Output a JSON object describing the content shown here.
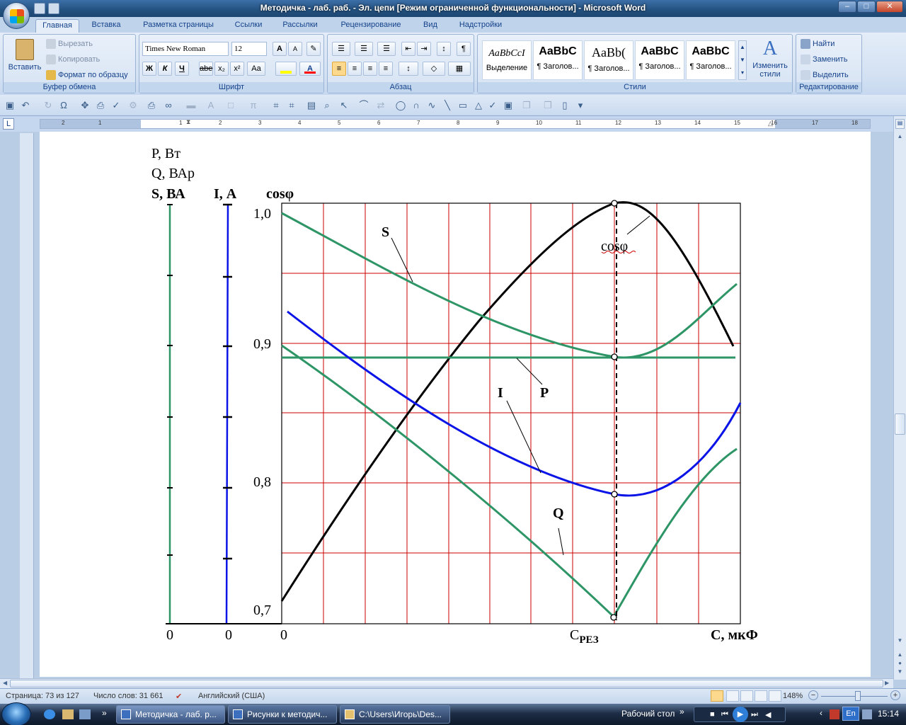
{
  "window": {
    "title": "Методичка - лаб. раб. - Эл. цепи [Режим ограниченной функциональности] - Microsoft Word",
    "buttons": [
      "–",
      "□",
      "✕"
    ]
  },
  "ribbon_tabs": [
    "Главная",
    "Вставка",
    "Разметка страницы",
    "Ссылки",
    "Рассылки",
    "Рецензирование",
    "Вид",
    "Надстройки"
  ],
  "clipboard": {
    "paste": "Вставить",
    "cut": "Вырезать",
    "copy": "Копировать",
    "format_painter": "Формат по образцу",
    "group": "Буфер обмена"
  },
  "font": {
    "name": "Times New Roman",
    "size": "12",
    "group": "Шрифт",
    "bold": "Ж",
    "italic": "К",
    "underline": "Ч",
    "strike": "abe",
    "subscript": "x₂",
    "superscript": "x²",
    "change_case": "Aa",
    "grow": "A",
    "shrink": "A",
    "highlight_color": "#ffff00",
    "font_color": "#ff0000"
  },
  "paragraph": {
    "group": "Абзац",
    "pilcrow": "¶"
  },
  "styles": {
    "group": "Стили",
    "items": [
      {
        "sample": "AaBbCcI",
        "name": "Выделение"
      },
      {
        "sample": "AaBbC",
        "name": "¶ Заголов..."
      },
      {
        "sample": "AaBb(",
        "name": "¶ Заголов..."
      },
      {
        "sample": "AaBbC",
        "name": "¶ Заголов..."
      },
      {
        "sample": "AaBbC",
        "name": "¶ Заголов..."
      }
    ],
    "change_styles": "Изменить стили"
  },
  "editing": {
    "group": "Редактирование",
    "find": "Найти",
    "replace": "Заменить",
    "select": "Выделить"
  },
  "ruler": {
    "numbers": [
      "2",
      "1",
      "1",
      "2",
      "3",
      "4",
      "5",
      "6",
      "7",
      "8",
      "9",
      "10",
      "11",
      "12",
      "13",
      "14",
      "15",
      "16",
      "17",
      "18"
    ]
  },
  "figure": {
    "left_labels": [
      "P, Вт",
      "Q,  ВАр",
      "S, ВА",
      "I, А",
      "cosφ"
    ],
    "y_ticks": [
      "1,0",
      "0,9",
      "0,8",
      "0,7"
    ],
    "zero_labels": [
      "0",
      "0",
      "0"
    ],
    "x_label_res_main": "C",
    "x_label_res_sub": "РЕЗ",
    "x_label": "С, мкФ",
    "curve_labels": {
      "S": "S",
      "P": "P",
      "I": "I",
      "Q": "Q",
      "cos": "cosφ"
    },
    "colors": {
      "green": "#2e9566",
      "blue": "#0a14e6",
      "black": "#000000",
      "grid": "#cc0000"
    }
  },
  "status": {
    "page": "Страница: 73 из 127",
    "words": "Число слов: 31 661",
    "language": "Английский (США)",
    "zoom": "148%"
  },
  "taskbar": {
    "tasks": [
      "Методичка - лаб. р...",
      "Рисунки к методич...",
      "C:\\Users\\Игорь\\Des..."
    ],
    "desktop": "Рабочий стол",
    "lang": "En",
    "time": "15:14"
  }
}
